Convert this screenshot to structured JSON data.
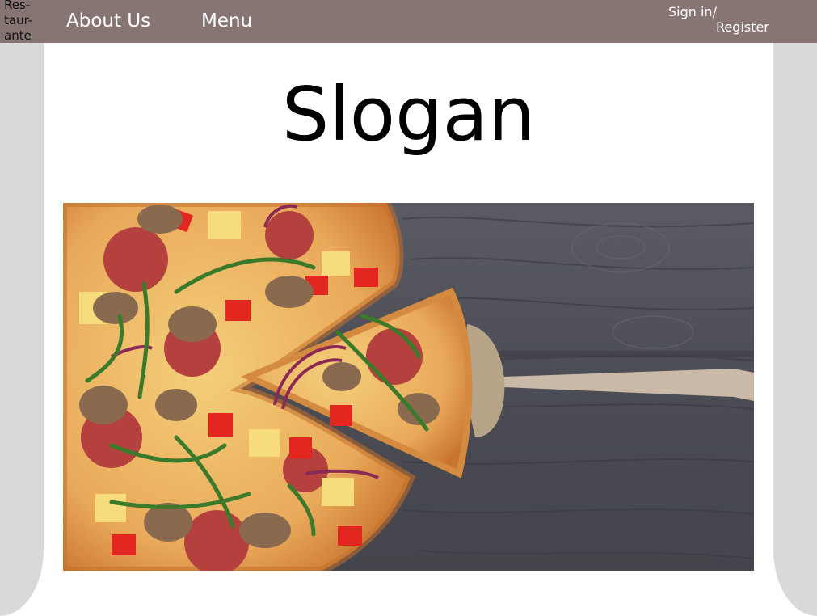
{
  "header": {
    "logo_text": "Res-\ntaur-\nante",
    "nav": {
      "about_label": "About Us",
      "menu_label": "Menu"
    },
    "auth": {
      "signin_label": "Sign in/",
      "register_label": "Register"
    }
  },
  "main": {
    "slogan": "Slogan",
    "hero_image": {
      "description_icon": "pizza-photo"
    }
  },
  "colors": {
    "navbar": "#877574",
    "page_background": "#d9d9d9",
    "panel": "#ffffff",
    "wood": "#4e4f56"
  }
}
